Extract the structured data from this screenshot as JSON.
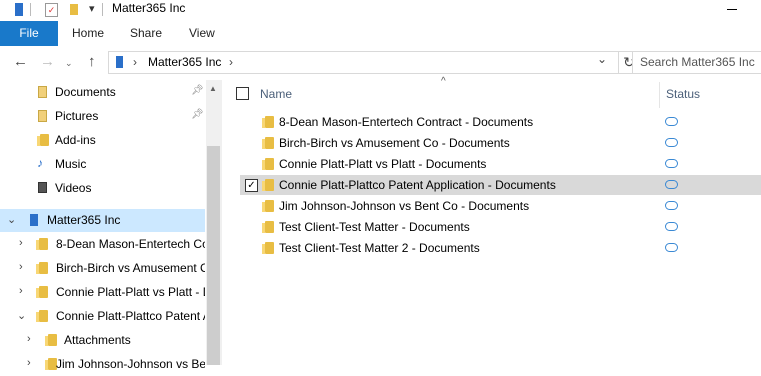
{
  "window": {
    "title": "Matter365 Inc"
  },
  "ribbon": {
    "file": "File",
    "tabs": [
      "Home",
      "Share",
      "View"
    ]
  },
  "address": {
    "root_icon": "building-icon",
    "path": [
      "Matter365 Inc"
    ],
    "separator": "›",
    "dropdown": "⌄"
  },
  "search": {
    "placeholder": "Search Matter365 Inc"
  },
  "nav": {
    "items": [
      {
        "label": "Documents",
        "icon": "documents-icon",
        "pinned": true
      },
      {
        "label": "Pictures",
        "icon": "pictures-icon",
        "pinned": true
      },
      {
        "label": "Add-ins",
        "icon": "folder-icon"
      },
      {
        "label": "Music",
        "icon": "music-icon"
      },
      {
        "label": "Videos",
        "icon": "videos-icon"
      },
      {
        "label": "Matter365 Inc",
        "icon": "building-icon",
        "expanded": true,
        "selected": true
      },
      {
        "label": "8-Dean Mason-Entertech Co",
        "icon": "folder-icon"
      },
      {
        "label": "Birch-Birch vs Amusement C",
        "icon": "folder-icon"
      },
      {
        "label": "Connie Platt-Platt vs Platt - D",
        "icon": "folder-icon"
      },
      {
        "label": "Connie Platt-Plattco Patent A",
        "icon": "folder-icon",
        "expanded": true
      },
      {
        "label": "Attachments",
        "icon": "folder-icon"
      },
      {
        "label": "Jim Johnson-Johnson vs Ben",
        "icon": "folder-icon"
      }
    ]
  },
  "columns": {
    "name": "Name",
    "status": "Status"
  },
  "files": [
    {
      "name": "8-Dean Mason-Entertech Contract - Documents",
      "status": "cloud"
    },
    {
      "name": "Birch-Birch vs Amusement Co - Documents",
      "status": "cloud"
    },
    {
      "name": "Connie Platt-Platt vs Platt - Documents",
      "status": "cloud"
    },
    {
      "name": "Connie Platt-Plattco Patent Application - Documents",
      "status": "cloud",
      "selected": true,
      "checked": true
    },
    {
      "name": "Jim Johnson-Johnson vs Bent Co - Documents",
      "status": "cloud"
    },
    {
      "name": "Test Client-Test Matter - Documents",
      "status": "cloud"
    },
    {
      "name": "Test Client-Test Matter 2 - Documents",
      "status": "cloud"
    }
  ],
  "colors": {
    "accent": "#1979ca",
    "selected_nav": "#cce8ff",
    "selected_row": "#d9d9d9",
    "folder": "#e8bd43",
    "cloud": "#3a89d4"
  }
}
